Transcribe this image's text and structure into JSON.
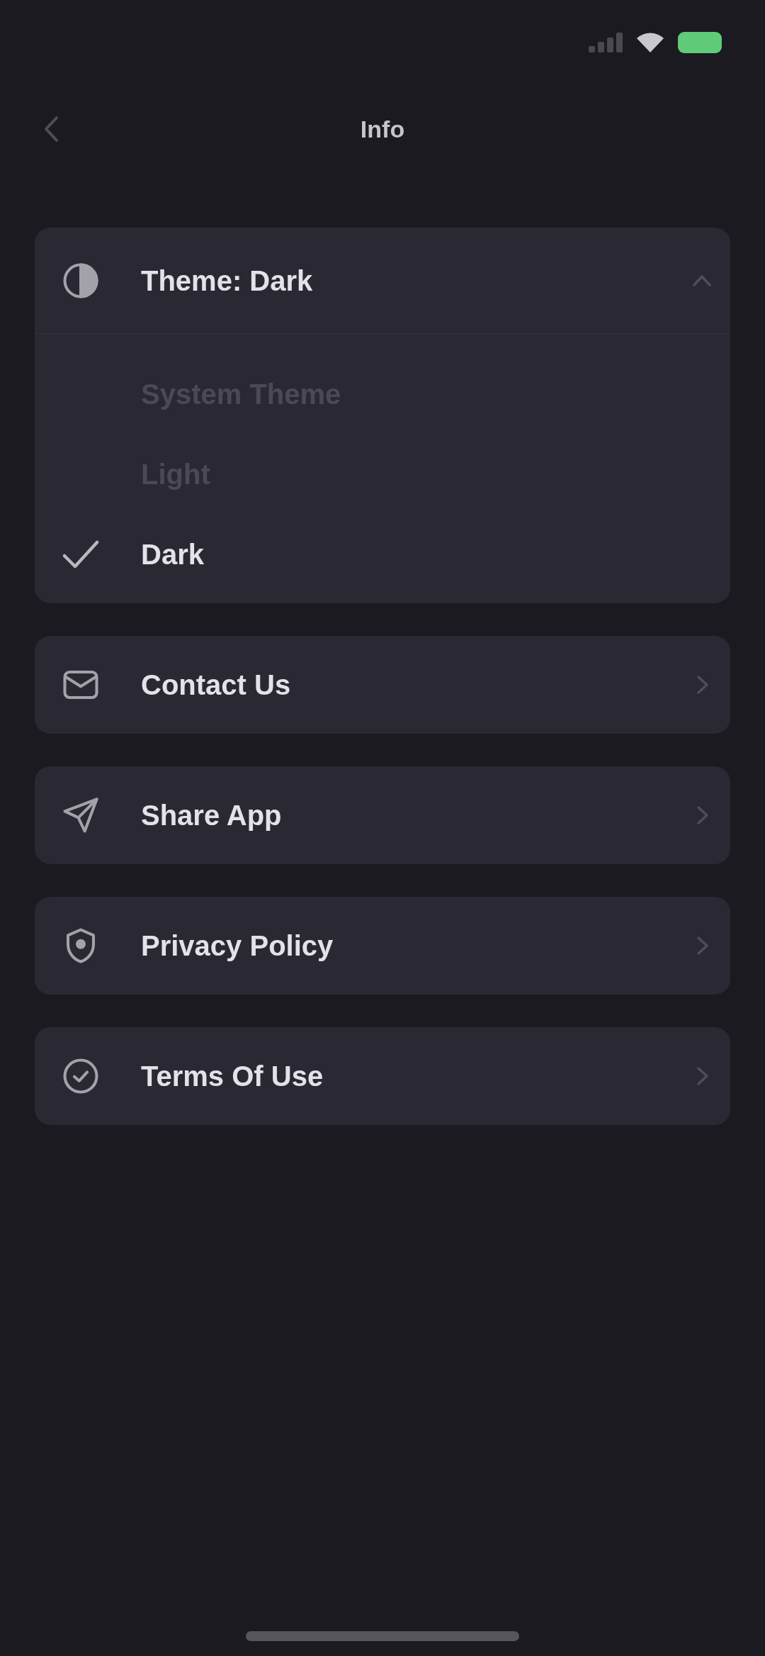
{
  "header": {
    "title": "Info"
  },
  "theme": {
    "title": "Theme: Dark",
    "expanded": true,
    "options": [
      {
        "label": "System Theme",
        "selected": false
      },
      {
        "label": "Light",
        "selected": false
      },
      {
        "label": "Dark",
        "selected": true
      }
    ]
  },
  "menu_items": [
    {
      "label": "Contact Us"
    },
    {
      "label": "Share App"
    },
    {
      "label": "Privacy Policy"
    },
    {
      "label": "Terms Of Use"
    }
  ]
}
